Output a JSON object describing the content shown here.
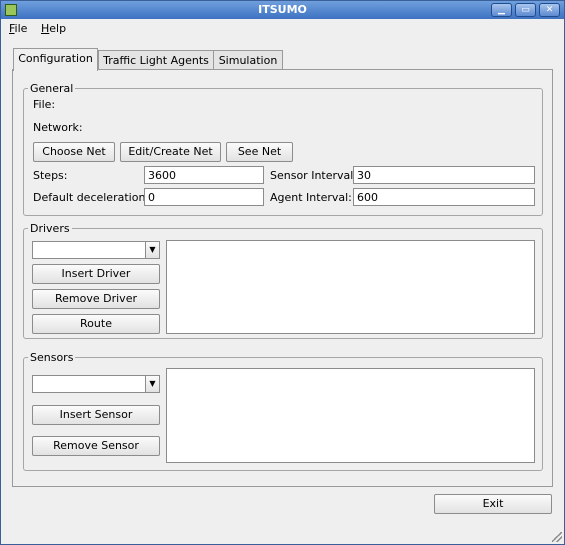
{
  "window": {
    "title": "ITSUMO",
    "minimize_icon": "minimize-icon",
    "maximize_icon": "maximize-icon",
    "close_icon": "close-icon"
  },
  "menu": [
    {
      "label": "File"
    },
    {
      "label": "Help"
    }
  ],
  "tabs": [
    {
      "label": "Configuration",
      "active": true
    },
    {
      "label": "Traffic Light Agents",
      "active": false
    },
    {
      "label": "Simulation",
      "active": false
    }
  ],
  "general": {
    "legend": "General",
    "file_label": "File:",
    "network_label": "Network:",
    "choose_net": "Choose Net",
    "edit_create_net": "Edit/Create Net",
    "see_net": "See Net",
    "steps_label": "Steps:",
    "steps_value": "3600",
    "sensor_interval_label": "Sensor Interval:",
    "sensor_interval_value": "30",
    "default_deceleration_label": "Default deceleration:",
    "default_deceleration_value": "0",
    "agent_interval_label": "Agent Interval:",
    "agent_interval_value": "600"
  },
  "drivers": {
    "legend": "Drivers",
    "selected": "",
    "insert": "Insert Driver",
    "remove": "Remove Driver",
    "route": "Route"
  },
  "sensors": {
    "legend": "Sensors",
    "selected": "",
    "insert": "Insert Sensor",
    "remove": "Remove Sensor"
  },
  "exit_label": "Exit",
  "colors": {
    "titlebar": "#3e72c2",
    "window_bg": "#efefef"
  }
}
